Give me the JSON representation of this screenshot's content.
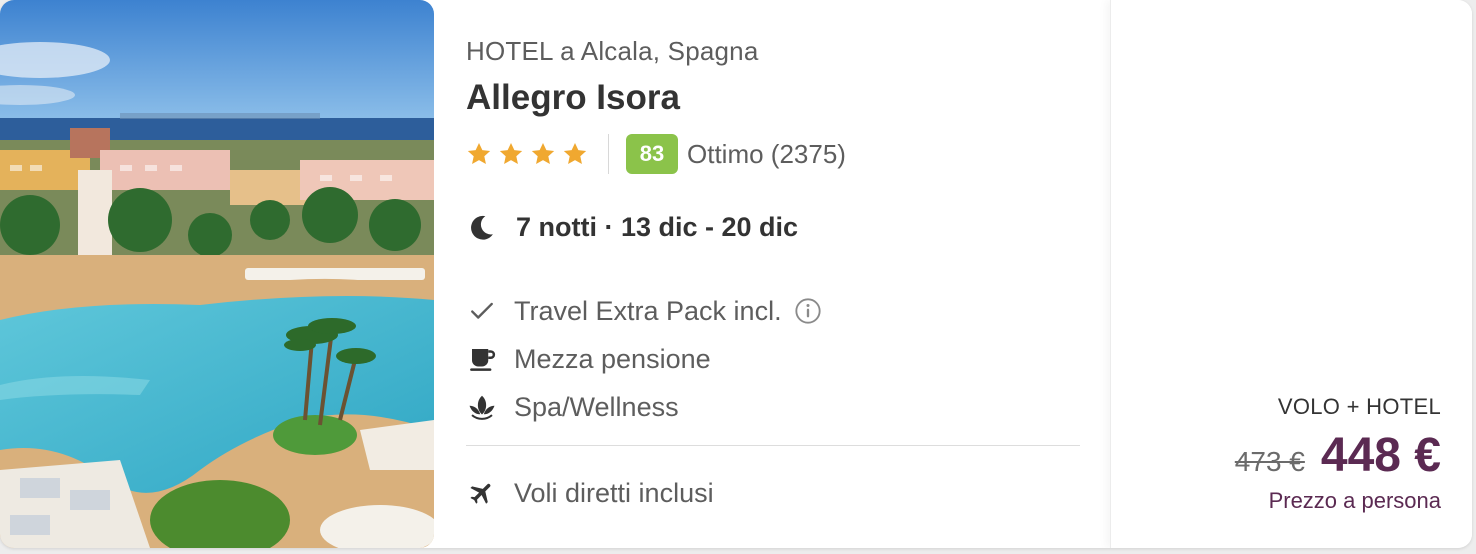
{
  "hotel": {
    "subtitle": "HOTEL a Alcala, Spagna",
    "name": "Allegro Isora",
    "stars": 4,
    "score": "83",
    "score_text": "Ottimo (2375)",
    "score_color": "#8bc34a",
    "star_color": "#f0a830"
  },
  "stay": {
    "icon": "moon-icon",
    "text": "7 notti · 13 dic - 20 dic"
  },
  "features": [
    {
      "icon": "check-icon",
      "label": "Travel Extra Pack incl."
    },
    {
      "icon": "coffee-cup-icon",
      "label": "Mezza pensione"
    },
    {
      "icon": "lotus-icon",
      "label": "Spa/Wellness"
    }
  ],
  "flight": {
    "icon": "airplane-icon",
    "label": "Voli diretti inclusi"
  },
  "price": {
    "type": "VOLO + HOTEL",
    "old": "473 €",
    "new": "448 €",
    "note": "Prezzo a persona",
    "accent_color": "#5b2a52"
  }
}
